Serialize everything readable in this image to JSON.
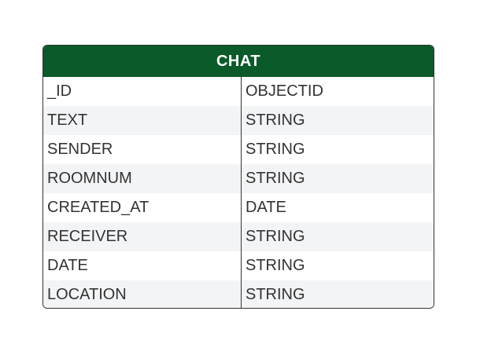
{
  "entity": {
    "title": "CHAT",
    "header_color": "#0b5a29",
    "fields": [
      {
        "name": "_ID",
        "type": "OBJECTID"
      },
      {
        "name": "TEXT",
        "type": "STRING"
      },
      {
        "name": "SENDER",
        "type": "STRING"
      },
      {
        "name": "ROOMNUM",
        "type": "STRING"
      },
      {
        "name": "CREATED_AT",
        "type": "DATE"
      },
      {
        "name": "RECEIVER",
        "type": "STRING"
      },
      {
        "name": "DATE",
        "type": "STRING"
      },
      {
        "name": "LOCATION",
        "type": "STRING"
      }
    ]
  }
}
